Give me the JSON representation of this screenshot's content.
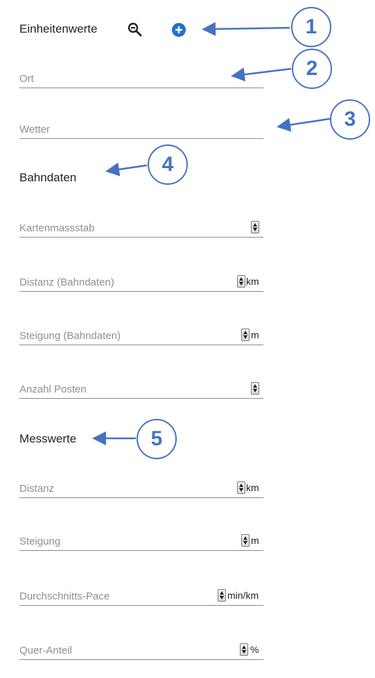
{
  "header": {
    "title": "Einheitenwerte",
    "search_icon": "zoom-out-icon",
    "add_icon": "add-circle-icon",
    "accent": "#1f6fd1"
  },
  "fields": {
    "ort": {
      "placeholder": "Ort"
    },
    "wetter": {
      "placeholder": "Wetter"
    }
  },
  "bahndaten": {
    "heading": "Bahndaten",
    "kartenmassstab": {
      "placeholder": "Kartenmassstab"
    },
    "distanz": {
      "placeholder": "Distanz (Bahndaten)",
      "unit": "km"
    },
    "steigung": {
      "placeholder": "Steigung (Bahndaten)",
      "unit": "m"
    },
    "anzahl_posten": {
      "placeholder": "Anzahl Posten"
    }
  },
  "messwerte": {
    "heading": "Messwerte",
    "distanz": {
      "placeholder": "Distanz",
      "unit": "km"
    },
    "steigung": {
      "placeholder": "Steigung",
      "unit": "m"
    },
    "pace": {
      "placeholder": "Durchschnitts-Pace",
      "unit": "min/km"
    },
    "quer_anteil": {
      "placeholder": "Quer-Anteil",
      "unit": "%"
    }
  },
  "callouts": [
    "1",
    "2",
    "3",
    "4",
    "5"
  ],
  "annotation_color": "#4472c4"
}
